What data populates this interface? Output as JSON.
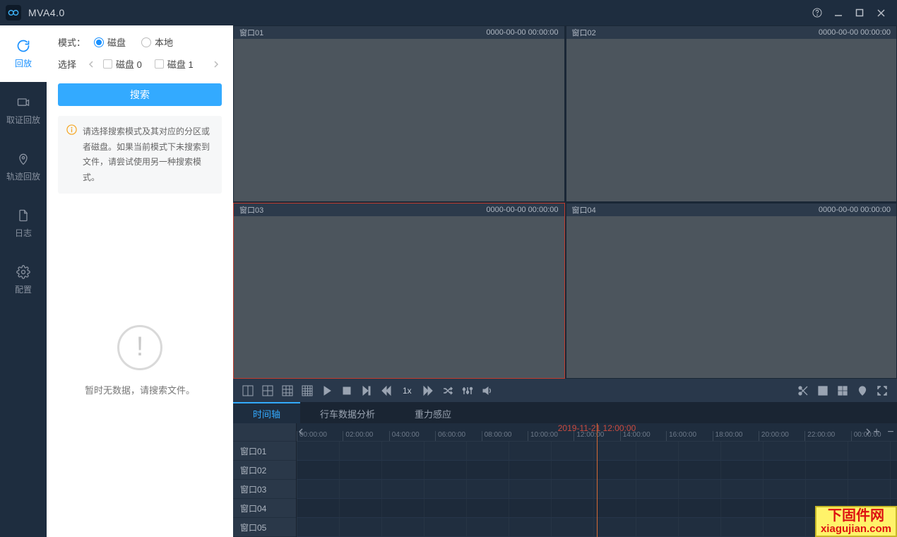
{
  "app": {
    "title": "MVA4.0"
  },
  "nav": {
    "items": [
      {
        "label": "回放"
      },
      {
        "label": "取证回放"
      },
      {
        "label": "轨迹回放"
      },
      {
        "label": "日志"
      },
      {
        "label": "配置"
      }
    ]
  },
  "side": {
    "mode_label": "模式：",
    "mode_opt_disk": "磁盘",
    "mode_opt_local": "本地",
    "select_label": "选择",
    "disk0": "磁盘 0",
    "disk1": "磁盘 1",
    "search_btn": "搜索",
    "info_text": "请选择搜索模式及其对应的分区或者磁盘。如果当前模式下未搜索到文件，请尝试使用另一种搜索模式。",
    "empty_text": "暂时无数据，请搜索文件。"
  },
  "viewports": [
    {
      "name": "窗口01",
      "ts": "0000-00-00 00:00:00"
    },
    {
      "name": "窗口02",
      "ts": "0000-00-00 00:00:00"
    },
    {
      "name": "窗口03",
      "ts": "0000-00-00 00:00:00"
    },
    {
      "name": "窗口04",
      "ts": "0000-00-00 00:00:00"
    }
  ],
  "toolbar": {
    "speed": "1x"
  },
  "tabs": [
    {
      "label": "时间轴"
    },
    {
      "label": "行车数据分析"
    },
    {
      "label": "重力感应"
    }
  ],
  "timeline": {
    "marker": "2019-11-21 12:00:00",
    "ticks": [
      "00:00:00",
      "02:00:00",
      "04:00:00",
      "06:00:00",
      "08:00:00",
      "10:00:00",
      "12:00:00",
      "14:00:00",
      "16:00:00",
      "18:00:00",
      "20:00:00",
      "22:00:00",
      "00:00:00"
    ],
    "rows": [
      "窗口01",
      "窗口02",
      "窗口03",
      "窗口04",
      "窗口05"
    ]
  },
  "watermark": {
    "line1": "下固件网",
    "line2": "xiagujian.com"
  }
}
